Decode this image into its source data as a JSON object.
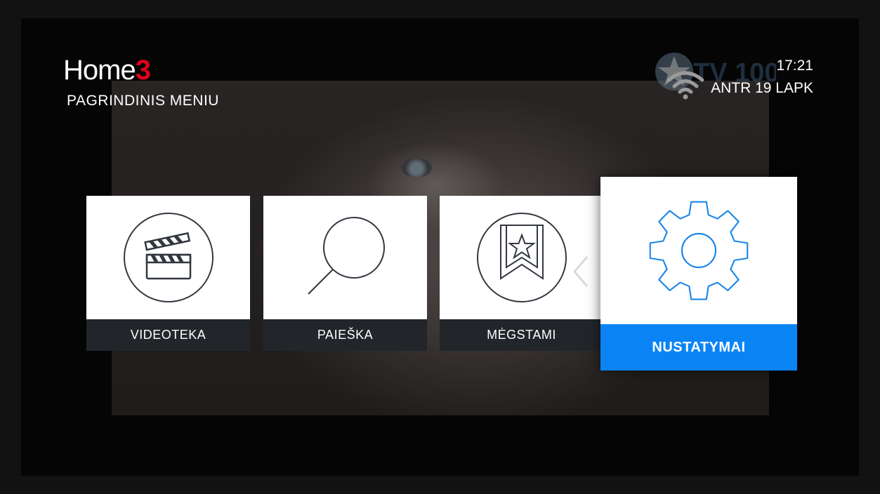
{
  "brand": {
    "name": "Home",
    "accent_glyph": "3",
    "accent_color": "#e2001a"
  },
  "page_title": "PAGRINDINIS MENIU",
  "status": {
    "time": "17:21",
    "date": "ANTR 19 LAPK",
    "wifi_icon": "wifi-icon"
  },
  "watermark": {
    "text": "TV 100"
  },
  "menu": {
    "items": [
      {
        "label": "VIDEOTEKA",
        "icon": "clapperboard-icon"
      },
      {
        "label": "PAIEŠKA",
        "icon": "search-icon"
      },
      {
        "label": "MĖGSTAMI",
        "icon": "bookmark-star-icon"
      },
      {
        "label": "NUSTATYMAI",
        "icon": "gear-icon",
        "selected": true
      }
    ]
  },
  "colors": {
    "selection": "#0a84f5",
    "label_bar": "#22262b",
    "icon_stroke": "#333840",
    "selected_icon": "#1a86e8"
  }
}
